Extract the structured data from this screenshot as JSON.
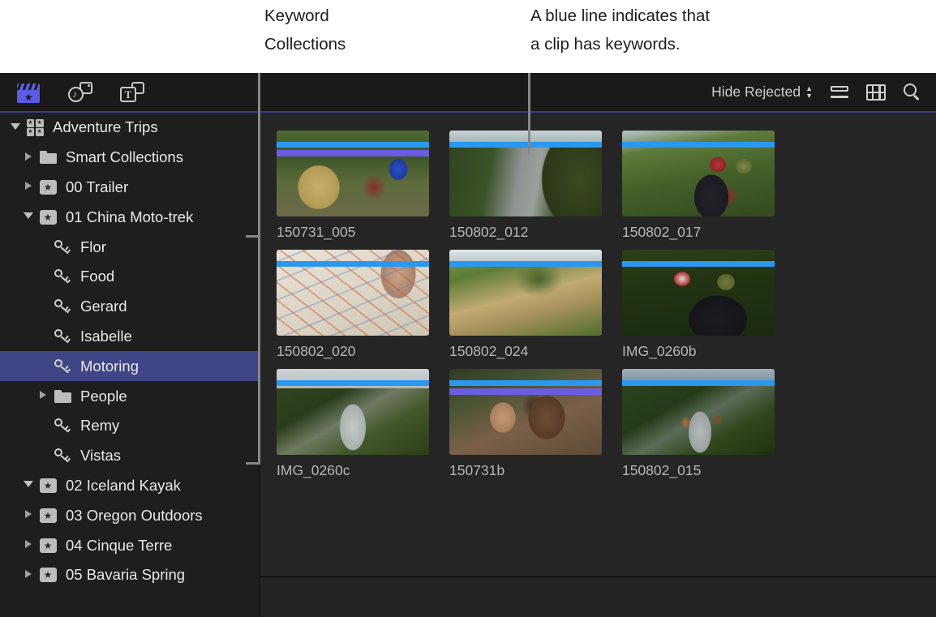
{
  "annotations": [
    {
      "id": "keyword-collections",
      "text": "Keyword\nCollections"
    },
    {
      "id": "blue-line",
      "text": "A blue line indicates that\na clip has keywords."
    }
  ],
  "annotation_lines": {
    "keyword_collections": "Keyword\nCollections",
    "blue_line": "A blue line indicates that\na clip has keywords."
  },
  "toolbar": {
    "left_icons": [
      {
        "name": "clapper-media-icon",
        "label": "Libraries",
        "active": true
      },
      {
        "name": "photos-audio-icon",
        "label": "Photos and Audio",
        "active": false
      },
      {
        "name": "titles-generators-icon",
        "label": "Titles and Generators",
        "active": false
      }
    ],
    "filter_label": "Hide Rejected",
    "right_icons": [
      {
        "name": "list-view-icon",
        "label": "List View"
      },
      {
        "name": "filmstrip-view-icon",
        "label": "Filmstrip View"
      },
      {
        "name": "search-icon",
        "label": "Search"
      }
    ]
  },
  "sidebar": {
    "items": [
      {
        "label": "Adventure Trips",
        "icon": "library-icon",
        "indent": 0,
        "disclosure": "down",
        "selected": false
      },
      {
        "label": "Smart Collections",
        "icon": "folder-icon",
        "indent": 1,
        "disclosure": "right",
        "selected": false
      },
      {
        "label": "00 Trailer",
        "icon": "event-icon",
        "indent": 1,
        "disclosure": "right",
        "selected": false
      },
      {
        "label": "01 China Moto-trek",
        "icon": "event-icon",
        "indent": 1,
        "disclosure": "down",
        "selected": false
      },
      {
        "label": "Flor",
        "icon": "keyword-icon",
        "indent": 2,
        "disclosure": "none",
        "selected": false
      },
      {
        "label": "Food",
        "icon": "keyword-icon",
        "indent": 2,
        "disclosure": "none",
        "selected": false
      },
      {
        "label": "Gerard",
        "icon": "keyword-icon",
        "indent": 2,
        "disclosure": "none",
        "selected": false
      },
      {
        "label": "Isabelle",
        "icon": "keyword-icon",
        "indent": 2,
        "disclosure": "none",
        "selected": false
      },
      {
        "label": "Motoring",
        "icon": "keyword-icon",
        "indent": 2,
        "disclosure": "none",
        "selected": true
      },
      {
        "label": "People",
        "icon": "folder-icon",
        "indent": 2,
        "disclosure": "right",
        "selected": false
      },
      {
        "label": "Remy",
        "icon": "keyword-icon",
        "indent": 2,
        "disclosure": "none",
        "selected": false
      },
      {
        "label": "Vistas",
        "icon": "keyword-icon",
        "indent": 2,
        "disclosure": "none",
        "selected": false
      },
      {
        "label": "02 Iceland Kayak",
        "icon": "event-icon",
        "indent": 1,
        "disclosure": "down",
        "selected": false
      },
      {
        "label": "03 Oregon Outdoors",
        "icon": "event-icon",
        "indent": 1,
        "disclosure": "right",
        "selected": false
      },
      {
        "label": "04 Cinque Terre",
        "icon": "event-icon",
        "indent": 1,
        "disclosure": "right",
        "selected": false
      },
      {
        "label": "05 Bavaria Spring",
        "icon": "event-icon",
        "indent": 1,
        "disclosure": "right",
        "selected": false
      }
    ]
  },
  "browser": {
    "clips": [
      {
        "name": "150731_005",
        "keyword_line": true,
        "favorite_line": true,
        "art": "p1"
      },
      {
        "name": "150802_012",
        "keyword_line": true,
        "favorite_line": false,
        "art": "p2"
      },
      {
        "name": "150802_017",
        "keyword_line": true,
        "favorite_line": false,
        "art": "p3"
      },
      {
        "name": "150802_020",
        "keyword_line": true,
        "favorite_line": false,
        "art": "p4"
      },
      {
        "name": "150802_024",
        "keyword_line": true,
        "favorite_line": false,
        "art": "p5"
      },
      {
        "name": "IMG_0260b",
        "keyword_line": true,
        "favorite_line": false,
        "art": "p6"
      },
      {
        "name": "IMG_0260c",
        "keyword_line": true,
        "favorite_line": false,
        "art": "p7"
      },
      {
        "name": "150731b",
        "keyword_line": true,
        "favorite_line": true,
        "art": "p8"
      },
      {
        "name": "150802_015",
        "keyword_line": true,
        "favorite_line": false,
        "art": "p9"
      }
    ]
  },
  "colors": {
    "keyword_line": "#2b98f0",
    "favorite_line": "#6a5de0",
    "selection": "#3f4585",
    "accent_underline": "#3c3c82",
    "window_background": "#1e1e1e",
    "browser_background": "#252525"
  }
}
